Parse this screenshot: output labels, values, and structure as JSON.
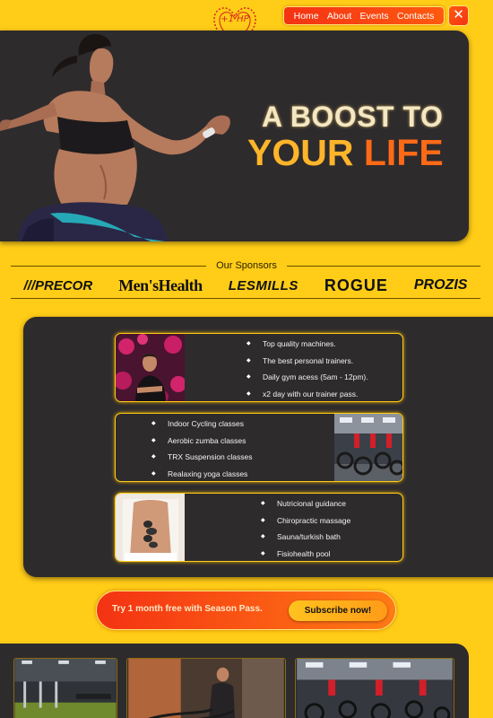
{
  "logo": {
    "text": "+1 HP"
  },
  "nav": {
    "items": [
      "Home",
      "About",
      "Events",
      "Contacts"
    ],
    "close_glyph": "✕"
  },
  "hero": {
    "line1": "A BOOST TO",
    "line2_a": "YOUR ",
    "line2_b": "LIFE"
  },
  "sponsors": {
    "title": "Our Sponsors",
    "brands": [
      "///PRECOR",
      "Men'sHealth",
      "LESMILLS",
      "ROGUE",
      "PROZIS"
    ]
  },
  "cards": [
    {
      "items": [
        "Top quality machines.",
        "The best personal trainers.",
        "Daily gym acess (5am - 12pm).",
        "x2 day with our trainer pass."
      ]
    },
    {
      "items": [
        "Indoor Cycling classes",
        "Aerobic zumba classes",
        "TRX Suspension classes",
        "Realaxing yoga classes"
      ]
    },
    {
      "items": [
        "Nutricional guidance",
        "Chiropractic massage",
        "Sauna/turkish bath",
        "Fisiohealth pool"
      ]
    }
  ],
  "cta": {
    "text": "Try 1 month free with Season Pass.",
    "button": "Subscribe now!"
  },
  "colors": {
    "accent": "#ffcc17",
    "dark": "#2e2b2d",
    "orange": "#f43213"
  }
}
